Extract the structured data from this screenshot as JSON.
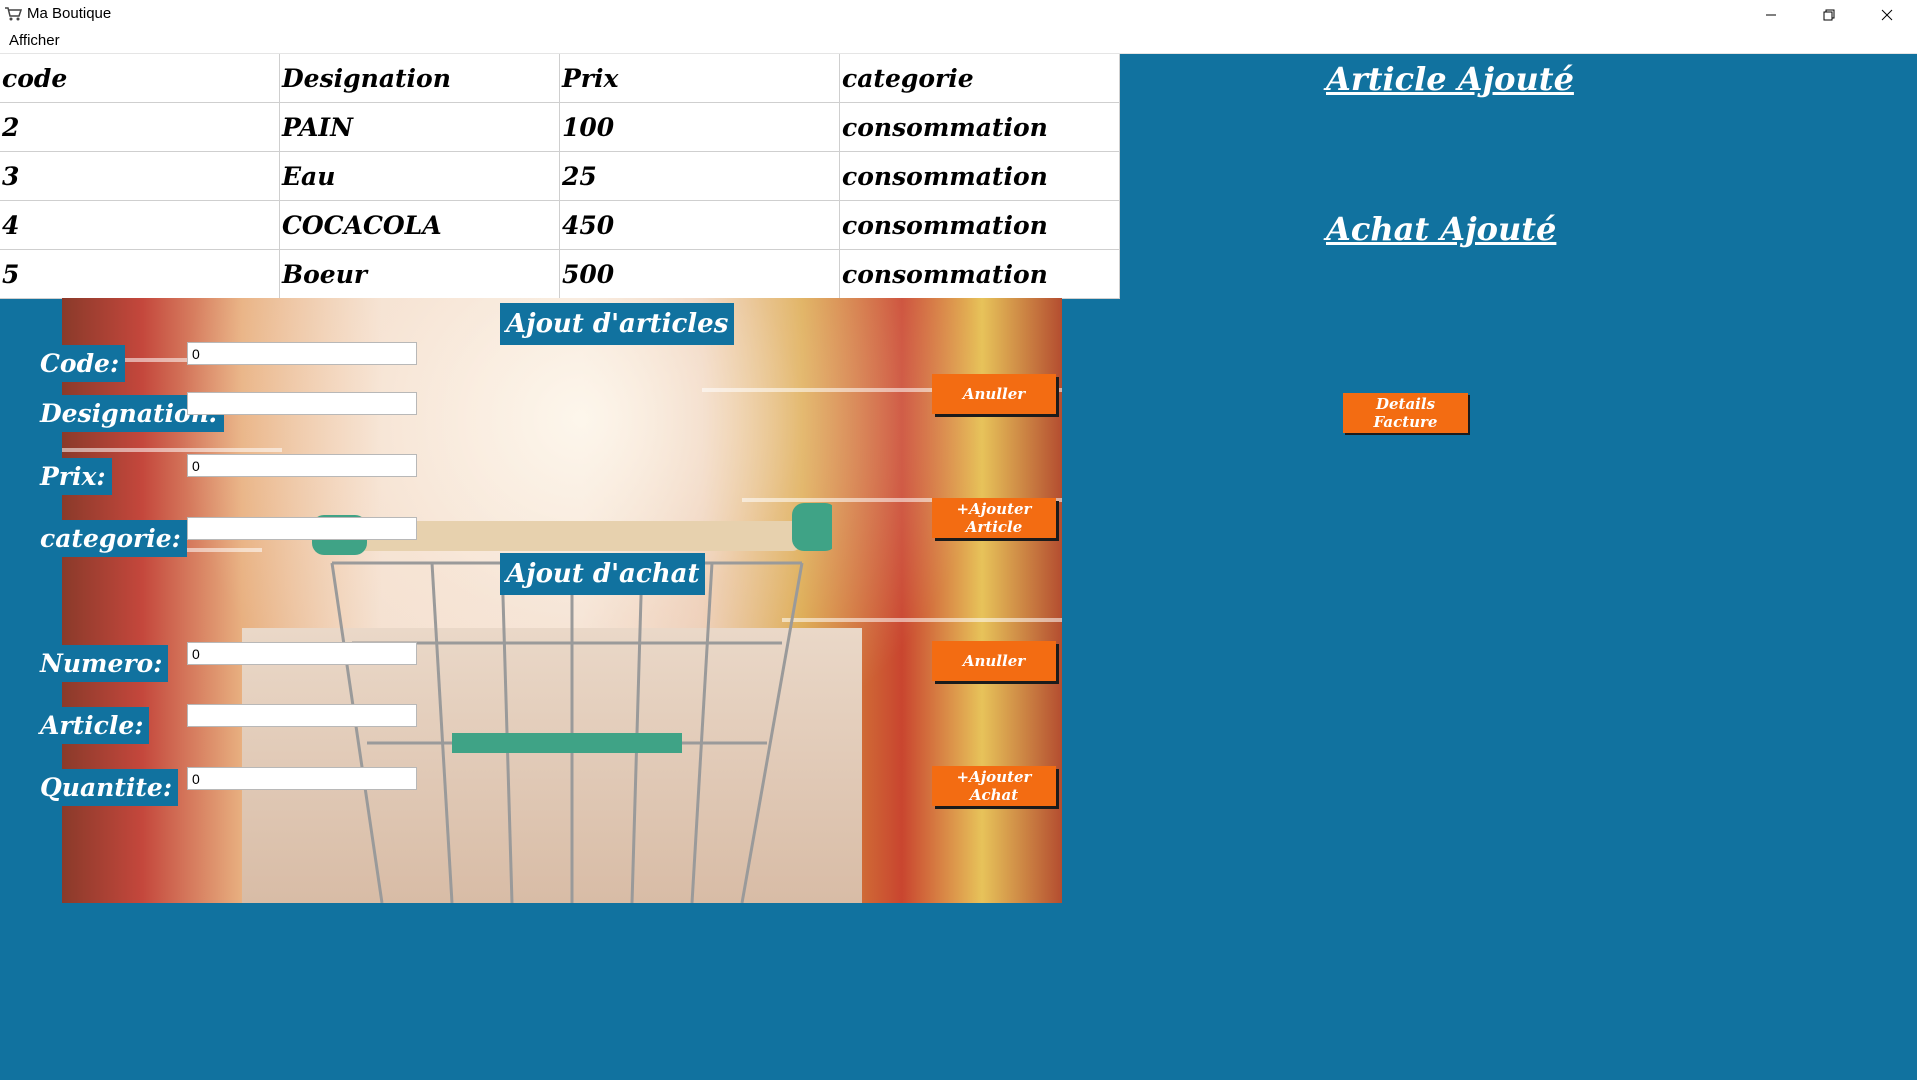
{
  "window": {
    "title": "Ma Boutique",
    "icon": "shopping-cart-icon"
  },
  "menu": {
    "items": [
      "Afficher"
    ]
  },
  "table": {
    "headers": [
      "code",
      "Designation",
      "Prix",
      "categorie"
    ],
    "rows": [
      [
        "2",
        "PAIN",
        "100",
        "consommation"
      ],
      [
        "3",
        "Eau",
        "25",
        "consommation"
      ],
      [
        "4",
        "COCACOLA",
        "450",
        "consommation"
      ],
      [
        "5",
        "Boeur",
        "500",
        "consommation"
      ]
    ]
  },
  "articles": {
    "section_title": "Ajout d'articles",
    "code_label": "Code:",
    "code_value": "0",
    "designation_label": "Designation:",
    "designation_value": "",
    "prix_label": "Prix:",
    "prix_value": "0",
    "categorie_label": "categorie:",
    "categorie_value": "",
    "cancel_label": "Anuller",
    "add_label": "+Ajouter Article"
  },
  "achat": {
    "section_title": "Ajout d'achat",
    "numero_label": "Numero:",
    "numero_value": "0",
    "article_label": "Article:",
    "article_value": "",
    "quantite_label": "Quantite:",
    "quantite_value": "0",
    "cancel_label": "Anuller",
    "add_label": "+Ajouter Achat"
  },
  "right_panel": {
    "article_added": "Article Ajouté",
    "achat_added": "Achat Ajouté",
    "facture_button": "Details Facture"
  },
  "colors": {
    "background": "#11729f",
    "button": "#f36c12"
  }
}
